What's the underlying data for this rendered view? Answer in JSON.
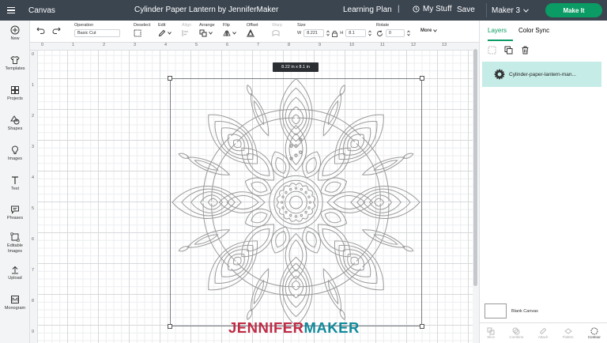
{
  "header": {
    "app_title": "Canvas",
    "project_title": "Cylinder Paper Lantern by JenniferMaker",
    "learning_plan": "Learning Plan",
    "separator": "|",
    "my_stuff": "My Stuff",
    "save": "Save",
    "machine": "Maker 3",
    "make_it": "Make It"
  },
  "sidebar": {
    "items": [
      {
        "label": "New",
        "icon": "plus-icon"
      },
      {
        "label": "Templates",
        "icon": "shirt-icon"
      },
      {
        "label": "Projects",
        "icon": "grid-icon"
      },
      {
        "label": "Shapes",
        "icon": "shapes-icon"
      },
      {
        "label": "Images",
        "icon": "bulb-icon"
      },
      {
        "label": "Text",
        "icon": "text-icon"
      },
      {
        "label": "Phrases",
        "icon": "speech-icon"
      },
      {
        "label": "Editable Images",
        "icon": "edit-image-icon"
      },
      {
        "label": "Upload",
        "icon": "upload-icon"
      },
      {
        "label": "Monogram",
        "icon": "monogram-icon"
      }
    ]
  },
  "toolbar": {
    "operation_label": "Operation",
    "operation_value": "Basic Cut",
    "deselect": "Deselect",
    "edit": "Edit",
    "align": "Align",
    "arrange": "Arrange",
    "flip": "Flip",
    "offset": "Offset",
    "warp": "Warp",
    "size_label": "Size",
    "w_label": "W",
    "w_value": "8.221",
    "h_label": "H",
    "h_value": "8.1",
    "rotate_label": "Rotate",
    "rotate_value": "0",
    "more": "More"
  },
  "rulers": {
    "top": [
      "0",
      "1",
      "2",
      "3",
      "4",
      "5",
      "6",
      "7",
      "8",
      "9",
      "10",
      "11",
      "12",
      "13"
    ],
    "left": [
      "0",
      "1",
      "2",
      "3",
      "4",
      "5",
      "6",
      "7",
      "8",
      "9"
    ]
  },
  "canvas": {
    "size_tooltip": "8.22  in x 8.1  in"
  },
  "watermark": {
    "part1": "JENNIFER",
    "part2": "MAKER"
  },
  "right_panel": {
    "tabs": [
      "Layers",
      "Color Sync"
    ],
    "layer_name": "Cylinder-paper-lantern-man...",
    "blank_canvas": "Blank Canvas",
    "bottom_actions": [
      "Slice",
      "Combine",
      "Attach",
      "Flatten",
      "Contour"
    ]
  },
  "colors": {
    "topbar": "#3b4550",
    "make_it": "#0b9b64",
    "layer_highlight": "#c6ece7",
    "watermark_red": "#c02b45",
    "watermark_teal": "#0f8a9b"
  }
}
